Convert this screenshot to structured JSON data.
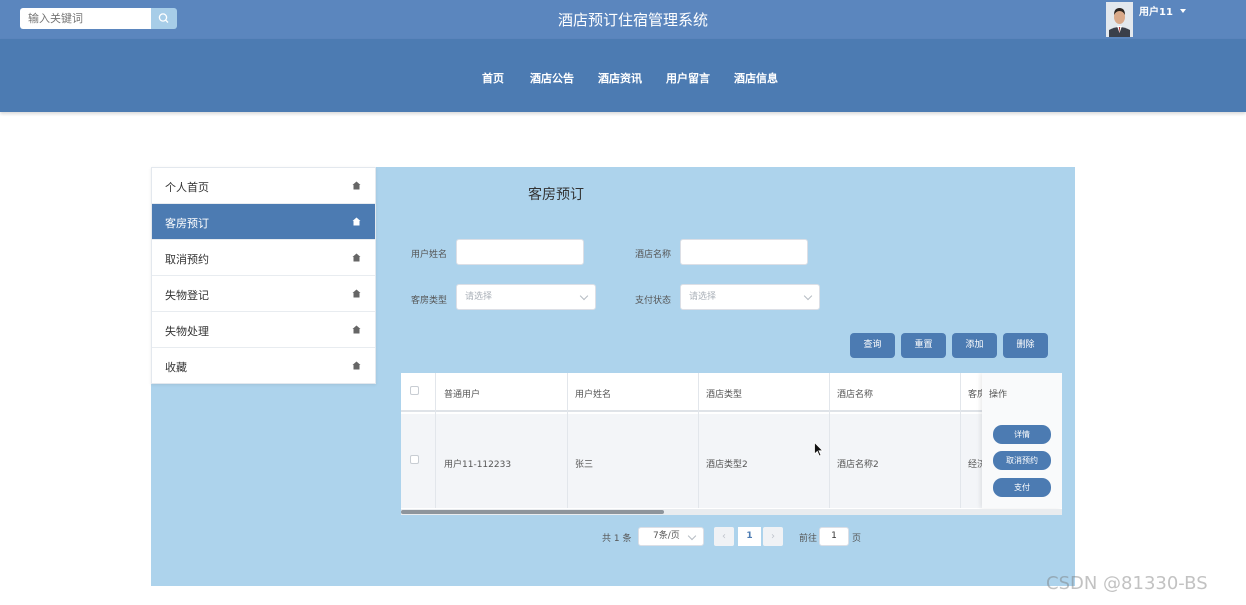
{
  "header": {
    "search_placeholder": "输入关键词",
    "title": "酒店预订住宿管理系统",
    "user_name": "用户11"
  },
  "nav": {
    "items": [
      {
        "label": "首页"
      },
      {
        "label": "酒店公告"
      },
      {
        "label": "酒店资讯"
      },
      {
        "label": "用户留言"
      },
      {
        "label": "酒店信息"
      }
    ]
  },
  "sidebar": {
    "items": [
      {
        "label": "个人首页",
        "active": false
      },
      {
        "label": "客房预订",
        "active": true
      },
      {
        "label": "取消预约",
        "active": false
      },
      {
        "label": "失物登记",
        "active": false
      },
      {
        "label": "失物处理",
        "active": false
      },
      {
        "label": "收藏",
        "active": false
      }
    ]
  },
  "main": {
    "title": "客房预订",
    "filters": {
      "user_name_label": "用户姓名",
      "user_name_value": "",
      "hotel_name_label": "酒店名称",
      "hotel_name_value": "",
      "room_type_label": "客房类型",
      "room_type_placeholder": "请选择",
      "pay_status_label": "支付状态",
      "pay_status_placeholder": "请选择"
    },
    "buttons": {
      "search": "查询",
      "reset": "重置",
      "add": "添加",
      "delete": "删除"
    },
    "table": {
      "headers": [
        "普通用户",
        "用户姓名",
        "酒店类型",
        "酒店名称",
        "客房",
        "操作"
      ],
      "rows": [
        {
          "user": "用户11-112233",
          "name": "张三",
          "hotel_type": "酒店类型2",
          "hotel_name": "酒店名称2",
          "room": "经济"
        }
      ],
      "row_actions": {
        "detail": "详情",
        "cancel": "取消预约",
        "pay": "支付"
      }
    },
    "pagination": {
      "total": "共 1 条",
      "page_size": "7条/页",
      "current_page": "1",
      "goto_label": "前往",
      "goto_value": "1",
      "page_suffix": "页"
    }
  },
  "watermark": "CSDN @81330-BS",
  "colors": {
    "topbar": "#5b86be",
    "navbar": "#4c7bb2",
    "panel": "#add3ec",
    "accent": "#4c7bb2"
  }
}
